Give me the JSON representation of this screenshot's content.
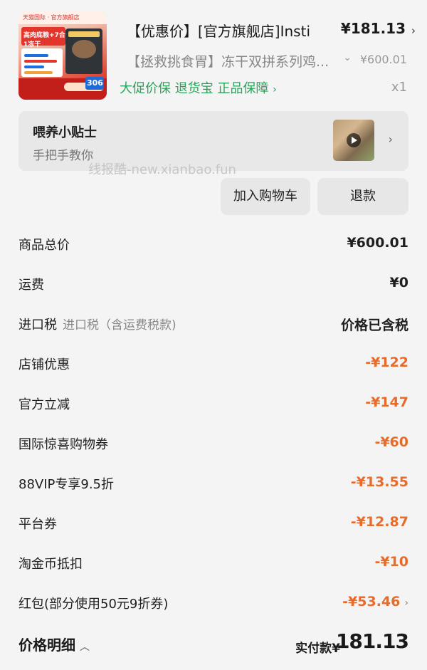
{
  "product": {
    "title": "【优惠价】[官方旗舰店]Insti",
    "price": "¥181.13",
    "subtitle": "【拯救挑食胃】冻干双拼系列鸡...",
    "original_price": "¥600.01",
    "tags": "大促价保  退货宝  正品保障",
    "quantity": "x1",
    "thumb_text": {
      "head": "高肉底粮+7合1冻干",
      "badge": "306"
    }
  },
  "tips": {
    "title": "喂养小贴士",
    "subtitle": "手把手教你"
  },
  "watermark": "线报酷-new.xianbao.fun",
  "actions": {
    "add_to_cart": "加入购物车",
    "refund": "退款"
  },
  "fees": [
    {
      "label": "商品总价",
      "note": "",
      "value": "¥600.01",
      "discount": false
    },
    {
      "label": "运费",
      "note": "",
      "value": "¥0",
      "discount": false
    },
    {
      "label": "进口税",
      "note": "进口税（含运费税款)",
      "value": "价格已含税",
      "discount": false
    },
    {
      "label": "店铺优惠",
      "note": "",
      "value": "-¥122",
      "discount": true
    },
    {
      "label": "官方立减",
      "note": "",
      "value": "-¥147",
      "discount": true
    },
    {
      "label": "国际惊喜购物券",
      "note": "",
      "value": "-¥60",
      "discount": true
    },
    {
      "label": "88VIP专享9.5折",
      "note": "",
      "value": "-¥13.55",
      "discount": true
    },
    {
      "label": "平台券",
      "note": "",
      "value": "-¥12.87",
      "discount": true
    },
    {
      "label": "淘金币抵扣",
      "note": "",
      "value": "-¥10",
      "discount": true
    },
    {
      "label": "红包(部分使用50元9折券)",
      "note": "",
      "value": "-¥53.46",
      "discount": true
    }
  ],
  "summary": {
    "label": "价格明细",
    "total_label": "实付款¥",
    "total_value": "181.13"
  },
  "colors": {
    "accent_green": "#2aa35b",
    "discount_orange": "#e86b2a"
  }
}
